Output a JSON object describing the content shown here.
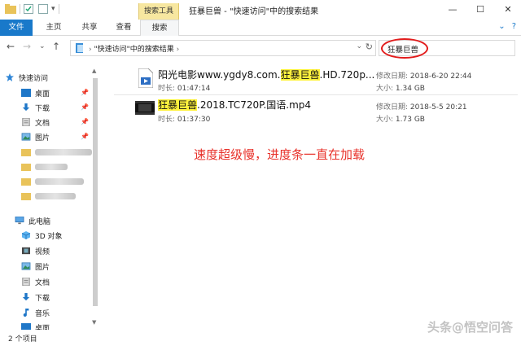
{
  "titlebar": {
    "context_tab": "搜索工具",
    "title": "狂暴巨兽 - \"快速访问\"中的搜索结果",
    "minimize": "—",
    "maximize": "☐",
    "close": "✕"
  },
  "ribbon": {
    "tabs": [
      "文件",
      "主页",
      "共享",
      "查看",
      "搜索"
    ],
    "chevron": "⌄",
    "help": "?"
  },
  "address": {
    "path": "\"快速访问\"中的搜索结果",
    "arrow": "›",
    "refresh": "↻",
    "search_value": "狂暴巨兽"
  },
  "nav": {
    "quick_access": "快速访问",
    "qa_items": [
      "桌面",
      "下载",
      "文档",
      "图片"
    ],
    "this_pc": "此电脑",
    "pc_items": [
      "3D 对象",
      "视频",
      "图片",
      "文档",
      "下载",
      "音乐",
      "桌面"
    ]
  },
  "files": [
    {
      "name_pre": "阳光电影www.ygdy8.com.",
      "name_hl": "狂暴巨兽",
      "name_post": ".HD.720p...",
      "duration_label": "时长:",
      "duration": "01:47:14",
      "modified_label": "修改日期:",
      "modified": "2018-6-20 22:44",
      "size_label": "大小:",
      "size": "1.34 GB"
    },
    {
      "name_pre": "",
      "name_hl": "狂暴巨兽",
      "name_post": ".2018.TC720P.国语.mp4",
      "duration_label": "时长:",
      "duration": "01:37:30",
      "modified_label": "修改日期:",
      "modified": "2018-5-5 20:21",
      "size_label": "大小:",
      "size": "1.73 GB"
    }
  ],
  "annotation": "速度超级慢，进度条一直在加载",
  "status": {
    "count": "2 个项目"
  },
  "watermark": "头条@悟空问答",
  "colors": {
    "accent": "#1979ca",
    "highlight": "#fff23d",
    "annotation": "#e8312a",
    "context_tab": "#f7e7a0"
  }
}
